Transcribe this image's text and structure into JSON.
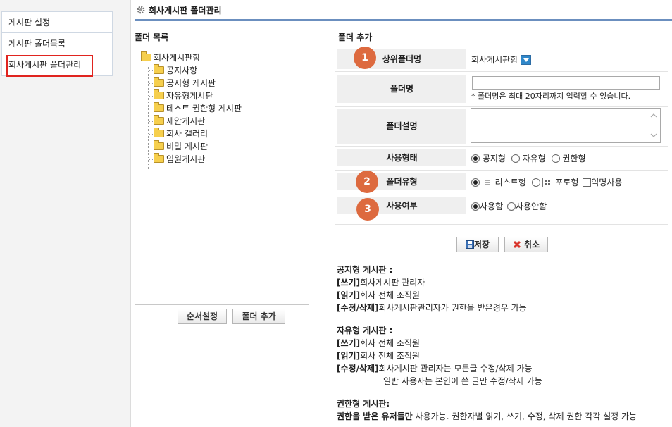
{
  "sidebar": {
    "items": [
      {
        "label": "게시판 설정"
      },
      {
        "label": "게시판 폴더목록"
      },
      {
        "label": "회사게시판 폴더관리"
      }
    ]
  },
  "header": {
    "title": "회사게시판 폴더관리",
    "icon": "gear-icon"
  },
  "folder_list": {
    "heading": "폴더 목록",
    "root": "회사게시판함",
    "children": [
      "공지사항",
      "공지형 게시판",
      "자유형게시판",
      "테스트 권한형 게시판",
      "제안게시판",
      "회사 갤러리",
      "비밀 게시판",
      "임원게시판"
    ],
    "order_button": "순서설정",
    "add_button": "폴더 추가"
  },
  "form": {
    "heading": "폴더 추가",
    "parent": {
      "badge": "1",
      "label": "상위폴더명",
      "value": "회사게시판함"
    },
    "name": {
      "label": "폴더명",
      "value": "",
      "hint": "* 폴더명은 최대 20자리까지 입력할 수 있습니다."
    },
    "desc": {
      "label": "폴더설명",
      "value": ""
    },
    "usage": {
      "label": "사용형태",
      "options": [
        "공지형",
        "자유형",
        "권한형"
      ],
      "selected": "공지형"
    },
    "type": {
      "badge": "2",
      "label": "폴더유형",
      "options": [
        "리스트형",
        "포토형"
      ],
      "selected": "리스트형",
      "anon": "익명사용"
    },
    "enabled": {
      "badge": "3",
      "label": "사용여부",
      "options": [
        "사용함",
        "사용안함"
      ],
      "selected": "사용함"
    },
    "save_label": "저장",
    "cancel_label": "취소"
  },
  "notes": {
    "notice": {
      "title": "공지형 게시판 :",
      "lines": [
        {
          "key": "[쓰기]",
          "text": "회사게시판 관리자"
        },
        {
          "key": "[읽기]",
          "text": "회사 전체 조직원"
        },
        {
          "key": "[수정/삭제]",
          "text": "회사게시판관리자가 권한을 받은경우 가능"
        }
      ]
    },
    "free": {
      "title": "자유형 게시판 :",
      "lines": [
        {
          "key": "[쓰기]",
          "text": "회사 전체 조직원"
        },
        {
          "key": "[읽기]",
          "text": "회사 전체 조직원"
        },
        {
          "key": "[수정/삭제]",
          "text": "회사게시판 관리자는 모든글 수정/삭제 가능"
        }
      ],
      "extra": "일반 사용자는 본인이 쓴 글만 수정/삭제 가능"
    },
    "perm": {
      "title": "권한형 게시판:",
      "key": "권한을 받은 유저들만",
      "text": " 사용가능. 권한자별 읽기, 쓰기, 수정, 삭제 권한 각각 설정 가능"
    }
  },
  "colors": {
    "accent": "#6b8fbf",
    "badge": "#dd6a3f",
    "highlight": "#e0241f"
  }
}
